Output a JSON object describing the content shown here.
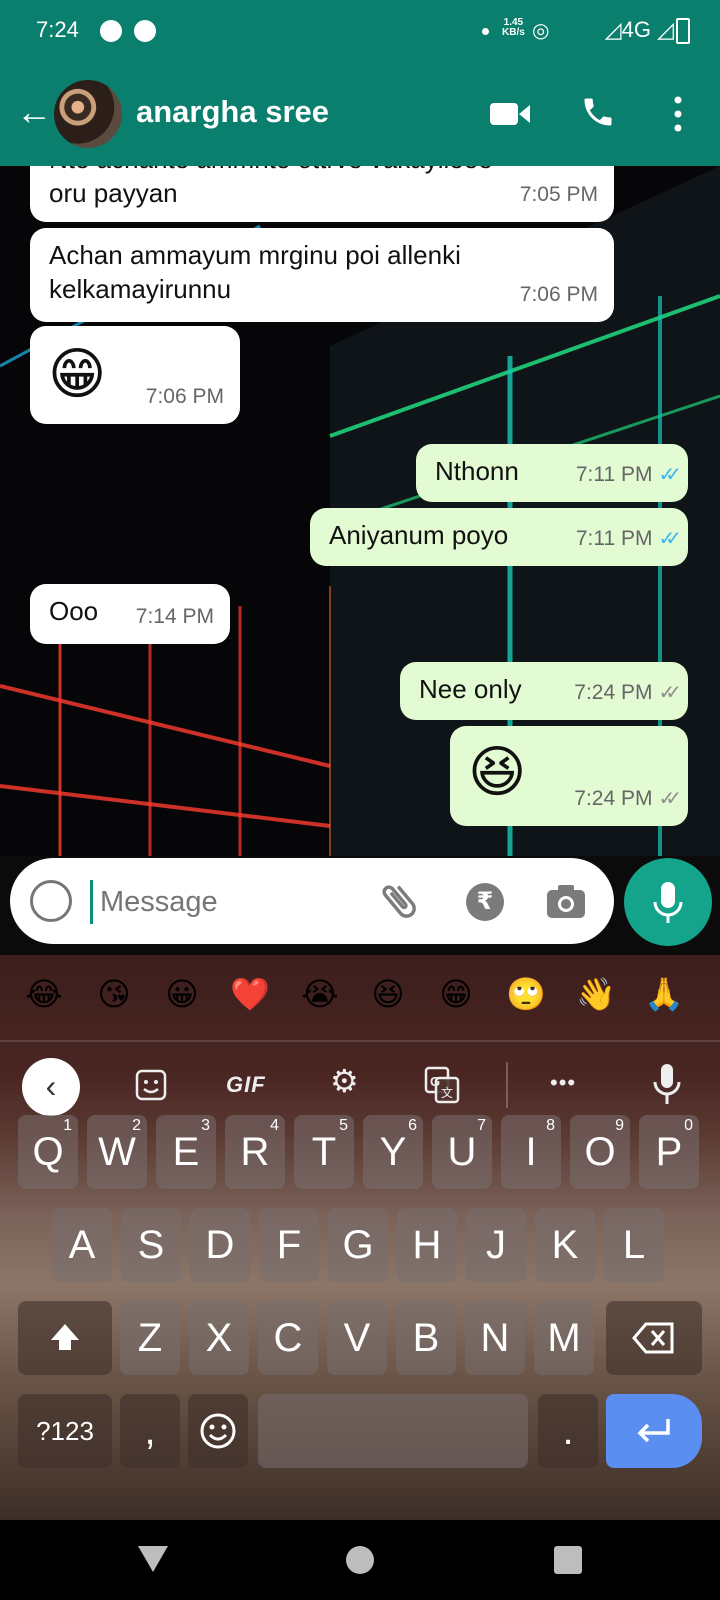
{
  "status_bar": {
    "time": "7:24",
    "net_speed": "1.45",
    "net_unit": "KB/s",
    "network": "4G"
  },
  "header": {
    "contact_name": "anargha sree"
  },
  "messages": [
    {
      "dir": "in",
      "text_line1": "Nte achante ammnte ottrve vakayileee",
      "text_line2": "oru payyan",
      "time": "7:05 PM"
    },
    {
      "dir": "in",
      "text_line1": "Achan ammayum mrginu poi allenki",
      "text_line2": "kelkamayirunnu",
      "time": "7:06 PM"
    },
    {
      "dir": "in",
      "emoji": "😁",
      "time": "7:06 PM"
    },
    {
      "dir": "out",
      "text": "Nthonn",
      "time": "7:11 PM",
      "status": "read"
    },
    {
      "dir": "out",
      "text": "Aniyanum poyo",
      "time": "7:11 PM",
      "status": "read"
    },
    {
      "dir": "in",
      "text": "Ooo",
      "time": "7:14 PM"
    },
    {
      "dir": "out",
      "text": "Nee only",
      "time": "7:24 PM",
      "status": "delivered"
    },
    {
      "dir": "out",
      "emoji": "😆",
      "time": "7:24 PM",
      "status": "delivered"
    }
  ],
  "composer": {
    "placeholder": "Message",
    "rupee_symbol": "₹"
  },
  "keyboard": {
    "emoji_suggestions": [
      "😂",
      "😘",
      "😀",
      "❤️",
      "😭",
      "😆",
      "😁",
      "🙄",
      "👋",
      "🙏"
    ],
    "gif_label": "GIF",
    "more_label": "•••",
    "row1": [
      {
        "k": "Q",
        "h": "1"
      },
      {
        "k": "W",
        "h": "2"
      },
      {
        "k": "E",
        "h": "3"
      },
      {
        "k": "R",
        "h": "4"
      },
      {
        "k": "T",
        "h": "5"
      },
      {
        "k": "Y",
        "h": "6"
      },
      {
        "k": "U",
        "h": "7"
      },
      {
        "k": "I",
        "h": "8"
      },
      {
        "k": "O",
        "h": "9"
      },
      {
        "k": "P",
        "h": "0"
      }
    ],
    "row2": [
      "A",
      "S",
      "D",
      "F",
      "G",
      "H",
      "J",
      "K",
      "L"
    ],
    "row3": [
      "Z",
      "X",
      "C",
      "V",
      "B",
      "N",
      "M"
    ],
    "symbols_label": "?123",
    "comma_label": ",",
    "period_label": "."
  },
  "colors": {
    "header": "#0a7f6e",
    "outgoing_bubble": "#e3fbd3",
    "incoming_bubble": "#ffffff",
    "read_ticks": "#34b7f1",
    "mic_button": "#14a38b",
    "enter_key": "#5a8ef0"
  }
}
